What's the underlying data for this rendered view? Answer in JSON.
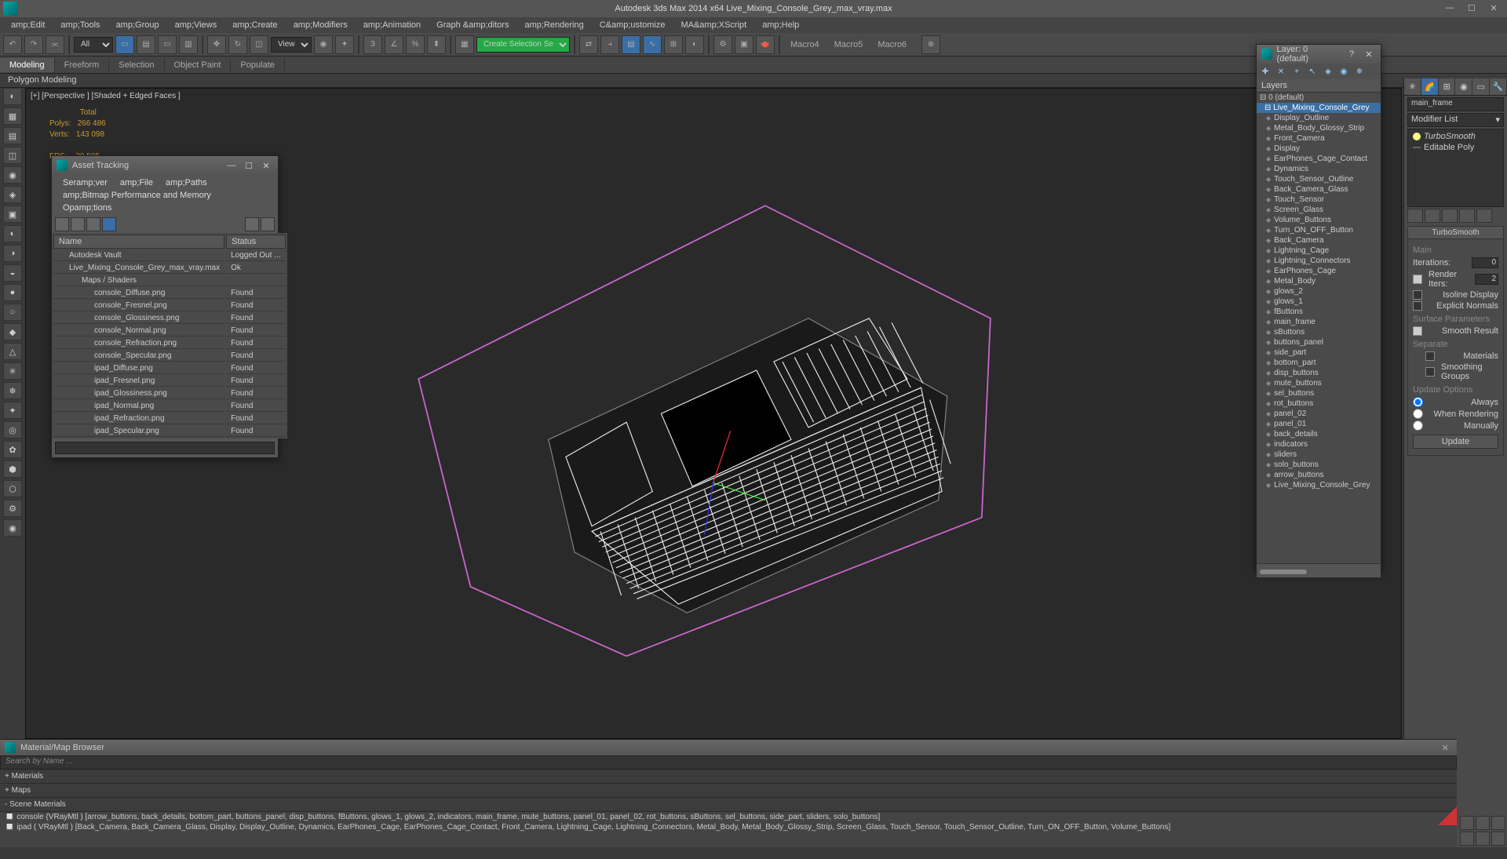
{
  "titlebar": {
    "title": "Autodesk 3ds Max  2014 x64   Live_Mixing_Console_Grey_max_vray.max"
  },
  "menu": [
    "amp;Edit",
    "amp;Tools",
    "amp;Group",
    "amp;Views",
    "amp;Create",
    "amp;Modifiers",
    "amp;Animation",
    "Graph &amp;ditors",
    "amp;Rendering",
    "C&amp;ustomize",
    "MA&amp;XScript",
    "amp;Help"
  ],
  "toolbar": {
    "sel1": "All",
    "sel2": "View",
    "sel3": "Create Selection Se",
    "macros": [
      "Macro4",
      "Macro5",
      "Macro6"
    ]
  },
  "ribbon": {
    "tabs": [
      "Modeling",
      "Freeform",
      "Selection",
      "Object Paint",
      "Populate"
    ],
    "sub": "Polygon Modeling"
  },
  "viewport": {
    "label": "[+] [Perspective ] [Shaded + Edged Faces ]",
    "stats": "              Total\nPolys:   266 486\nVerts:   143 098\n\nFPS:    30,505"
  },
  "asset": {
    "title": "Asset Tracking",
    "menu": [
      "Seramp;ver",
      "amp;File",
      "amp;Paths",
      "amp;Bitmap Performance and Memory",
      "Opamp;tions"
    ],
    "cols": [
      "Name",
      "Status"
    ],
    "rows": [
      {
        "indent": 1,
        "icon": "vault",
        "name": "Autodesk Vault",
        "status": "Logged Out ..."
      },
      {
        "indent": 1,
        "icon": "max",
        "name": "Live_Mixing_Console_Grey_max_vray.max",
        "status": "Ok"
      },
      {
        "indent": 2,
        "icon": "folder",
        "name": "Maps / Shaders",
        "status": ""
      },
      {
        "indent": 3,
        "icon": "img",
        "name": "console_Diffuse.png",
        "status": "Found"
      },
      {
        "indent": 3,
        "icon": "img",
        "name": "console_Fresnel.png",
        "status": "Found"
      },
      {
        "indent": 3,
        "icon": "img",
        "name": "console_Glossiness.png",
        "status": "Found"
      },
      {
        "indent": 3,
        "icon": "img",
        "name": "console_Normal.png",
        "status": "Found"
      },
      {
        "indent": 3,
        "icon": "img",
        "name": "console_Refraction.png",
        "status": "Found"
      },
      {
        "indent": 3,
        "icon": "img",
        "name": "console_Specular.png",
        "status": "Found"
      },
      {
        "indent": 3,
        "icon": "img",
        "name": "ipad_Diffuse.png",
        "status": "Found"
      },
      {
        "indent": 3,
        "icon": "img",
        "name": "ipad_Fresnel.png",
        "status": "Found"
      },
      {
        "indent": 3,
        "icon": "img",
        "name": "ipad_Glossiness.png",
        "status": "Found"
      },
      {
        "indent": 3,
        "icon": "img",
        "name": "ipad_Normal.png",
        "status": "Found"
      },
      {
        "indent": 3,
        "icon": "img",
        "name": "ipad_Refraction.png",
        "status": "Found"
      },
      {
        "indent": 3,
        "icon": "img",
        "name": "ipad_Specular.png",
        "status": "Found"
      }
    ]
  },
  "layer": {
    "title": "Layer: 0 (default)",
    "header": "Layers",
    "root": "0 (default)",
    "group": "Live_Mixing_Console_Grey",
    "items": [
      "Display_Outline",
      "Metal_Body_Glossy_Strip",
      "Front_Camera",
      "Display",
      "EarPhones_Cage_Contact",
      "Dynamics",
      "Touch_Sensor_Outline",
      "Back_Camera_Glass",
      "Touch_Sensor",
      "Screen_Glass",
      "Volume_Buttons",
      "Turn_ON_OFF_Button",
      "Back_Camera",
      "Lightning_Cage",
      "Lightning_Connectors",
      "EarPhones_Cage",
      "Metal_Body",
      "glows_2",
      "glows_1",
      "fButtons",
      "main_frame",
      "sButtons",
      "buttons_panel",
      "side_part",
      "bottom_part",
      "disp_buttons",
      "mute_buttons",
      "sel_buttons",
      "rot_buttons",
      "panel_02",
      "panel_01",
      "back_details",
      "indicators",
      "sliders",
      "solo_buttons",
      "arrow_buttons",
      "Live_Mixing_Console_Grey"
    ]
  },
  "cmd": {
    "objname": "main_frame",
    "modlist_label": "Modifier List",
    "stack": [
      "TurboSmooth",
      "Editable Poly"
    ],
    "rollout1": {
      "title": "TurboSmooth",
      "main": "Main",
      "iter_label": "Iterations:",
      "iter_val": "0",
      "render_label": "Render Iters:",
      "render_val": "2",
      "isoline": "Isoline Display",
      "explicit": "Explicit Normals",
      "surf": "Surface Parameters",
      "smooth": "Smooth Result",
      "sep": "Separate",
      "mats": "Materials",
      "sg": "Smoothing Groups",
      "upd": "Update Options",
      "always": "Always",
      "whenr": "When Rendering",
      "manual": "Manually",
      "update_btn": "Update"
    }
  },
  "mat": {
    "title": "Material/Map Browser",
    "search": "Search by Name ...",
    "hdr1": "+ Materials",
    "hdr2": "+ Maps",
    "hdr3": "- Scene Materials",
    "items": [
      "console (VRayMtl ) [arrow_buttons, back_details, bottom_part, buttons_panel, disp_buttons, fButtons, glows_1, glows_2, indicators, main_frame, mute_buttons, panel_01, panel_02, rot_buttons, sButtons, sel_buttons, side_part, sliders, solo_buttons]",
      "ipad ( VRayMtl ) [Back_Camera, Back_Camera_Glass, Display, Display_Outline, Dynamics, EarPhones_Cage, EarPhones_Cage_Contact, Front_Camera, Lightning_Cage, Lightning_Connectors, Metal_Body, Metal_Body_Glossy_Strip, Screen_Glass, Touch_Sensor, Touch_Sensor_Outline, Turn_ON_OFF_Button, Volume_Buttons]"
    ]
  }
}
